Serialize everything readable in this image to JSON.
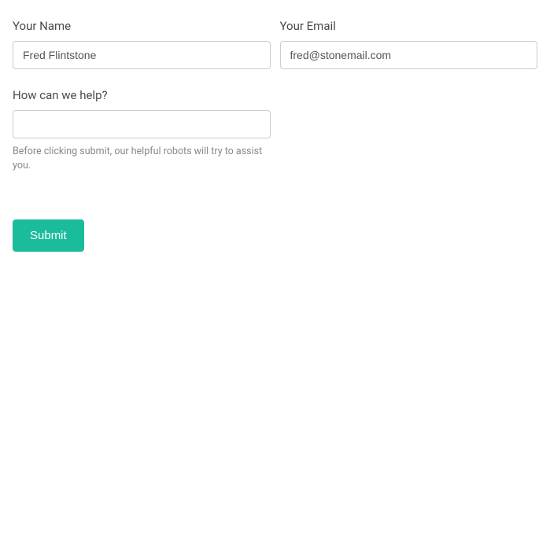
{
  "form": {
    "name": {
      "label": "Your Name",
      "value": "Fred Flintstone"
    },
    "email": {
      "label": "Your Email",
      "value": "fred@stonemail.com"
    },
    "help": {
      "label": "How can we help?",
      "value": "",
      "hint": "Before clicking submit, our helpful robots will try to assist you."
    },
    "submit_label": "Submit"
  }
}
